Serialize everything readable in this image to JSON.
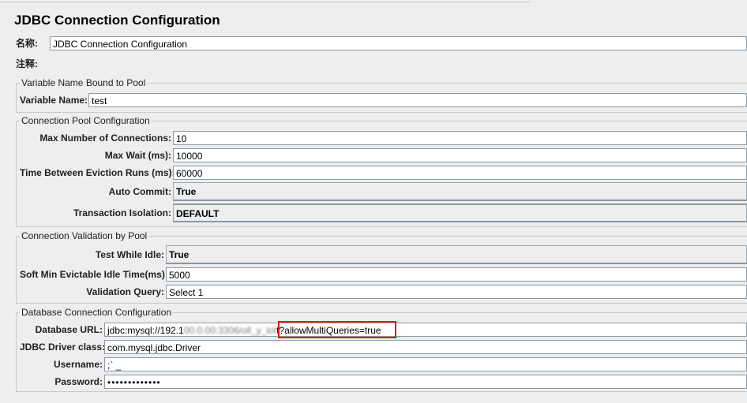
{
  "header": {
    "title": "JDBC Connection Configuration"
  },
  "basic": {
    "name_label": "名称:",
    "name_value": "JDBC Connection Configuration",
    "comment_label": "注释:",
    "comment_value": ""
  },
  "variable_group": {
    "legend": "Variable Name Bound to Pool",
    "var_label": "Variable Name:",
    "var_value": "test"
  },
  "pool_group": {
    "legend": "Connection Pool Configuration",
    "max_conn_label": "Max Number of Connections:",
    "max_conn_value": "10",
    "max_wait_label": "Max Wait (ms):",
    "max_wait_value": "10000",
    "eviction_label": "Time Between Eviction Runs (ms):",
    "eviction_value": "60000",
    "auto_commit_label": "Auto Commit:",
    "auto_commit_value": "True",
    "isolation_label": "Transaction Isolation:",
    "isolation_value": "DEFAULT"
  },
  "validation_group": {
    "legend": "Connection Validation by Pool",
    "test_idle_label": "Test While Idle:",
    "test_idle_value": "True",
    "soft_min_label": "Soft Min Evictable Idle Time(ms):",
    "soft_min_value": "5000",
    "query_label": "Validation Query:",
    "query_value": "Select 1"
  },
  "db_group": {
    "legend": "Database Connection Configuration",
    "url_label": "Database URL:",
    "url_value_prefix": "jdbc:mysql://192.1",
    "url_value_blurred": "00.0.00:3306/oll_y_lot",
    "url_value_highlight": "t?allowMultiQueries=true",
    "driver_label": "JDBC Driver class:",
    "driver_value": "com.mysql.jdbc.Driver",
    "username_label": "Username:",
    "username_value": ";`  _",
    "password_label": "Password:",
    "password_value": "•••••••••••••"
  },
  "colors": {
    "highlight": "#e11c1c",
    "panel_bg": "#eeeeee"
  }
}
